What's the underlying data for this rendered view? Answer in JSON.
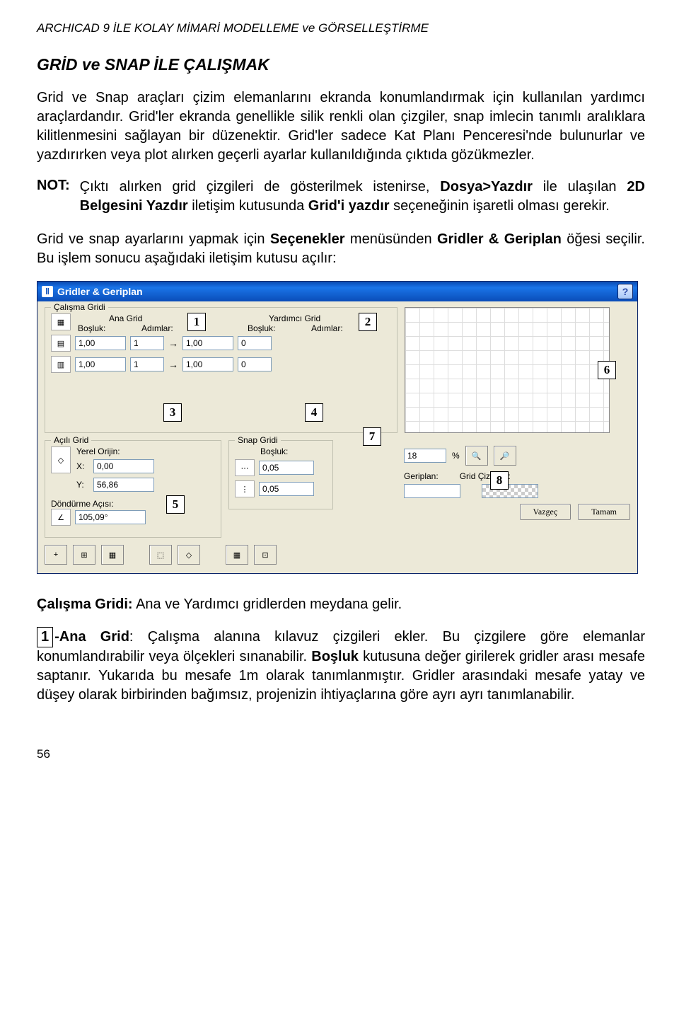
{
  "header": "ARCHICAD 9 İLE KOLAY MİMARİ MODELLEME ve GÖRSELLEŞTİRME",
  "section_title": "GRİD ve SNAP İLE ÇALIŞMAK",
  "para1_a": "Grid ve Snap araçları çizim elemanlarını ekranda konumlandırmak için kullanılan yardımcı araçlardandır. Grid'ler ekranda genellikle silik renkli olan çizgiler, snap imlecin tanımlı aralıklara kilitlenmesini sağlayan bir düzenektir. Grid'ler sadece Kat Planı Penceresi'nde bulunurlar ve yazdırırken veya plot alırken geçerli ayarlar kullanıldığında çıktıda gözükmezler.",
  "note_label": "NOT:",
  "note_a": "Çıktı alırken grid çizgileri de gösterilmek istenirse, ",
  "note_b": "Dosya>Yazdır",
  "note_c": " ile ulaşılan ",
  "note_d": "2D Belgesini Yazdır",
  "note_e": " iletişim kutusunda ",
  "note_f": "Grid'i yazdır",
  "note_g": " seçeneğinin işaretli olması gerekir.",
  "para2_a": "Grid ve snap ayarlarını yapmak için ",
  "para2_b": "Seçenekler",
  "para2_c": " menüsünden ",
  "para2_d": "Gridler & Geriplan",
  "para2_e": " öğesi seçilir. Bu işlem sonucu aşağıdaki iletişim kutusu açılır:",
  "dialog": {
    "title": "Gridler & Geriplan",
    "help": "?",
    "calisma": {
      "legend": "Çalışma Gridi",
      "ana_grid": "Ana Grid",
      "bosluk": "Boşluk:",
      "adimlar": "Adımlar:",
      "yardimci": "Yardımcı Grid",
      "rows": [
        {
          "b1": "1,00",
          "a1": "1",
          "b2": "1,00",
          "a2": "0"
        },
        {
          "b1": "1,00",
          "a1": "1",
          "b2": "1,00",
          "a2": "0"
        }
      ]
    },
    "acili": {
      "legend": "Açılı Grid",
      "yerel": "Yerel Orijin:",
      "x_lbl": "X:",
      "x_val": "0,00",
      "y_lbl": "Y:",
      "y_val": "56,86",
      "dondurme": "Döndürme Açısı:",
      "aci_val": "105,09°"
    },
    "snap": {
      "legend": "Snap Gridi",
      "bosluk": "Boşluk:",
      "h_val": "0,05",
      "v_val": "0,05"
    },
    "zoom_val": "18",
    "percent": "%",
    "geriplan": "Geriplan:",
    "grid_ciz": "Grid Çizgileri:",
    "vazgec": "Vazgeç",
    "tamam": "Tamam"
  },
  "callouts": {
    "c1": "1",
    "c2": "2",
    "c3": "3",
    "c4": "4",
    "c5": "5",
    "c6": "6",
    "c7": "7",
    "c8": "8"
  },
  "sub1_a": "Çalışma Gridi:",
  "sub1_b": " Ana ve Yardımcı gridlerden meydana gelir.",
  "sub2_num": "1",
  "sub2_a": "-Ana Grid",
  "sub2_b": ": Çalışma alanına kılavuz çizgileri ekler. Bu çizgilere göre elemanlar konumlandırabilir veya ölçekleri sınanabilir. ",
  "sub2_c": "Boşluk",
  "sub2_d": " kutusuna değer girilerek gridler arası mesafe saptanır. Yukarıda bu mesafe 1m olarak tanımlanmıştır. Gridler arasındaki mesafe yatay ve düşey olarak birbirinden bağımsız, projenizin ihtiyaçlarına göre ayrı ayrı tanımlanabilir.",
  "page_num": "56"
}
